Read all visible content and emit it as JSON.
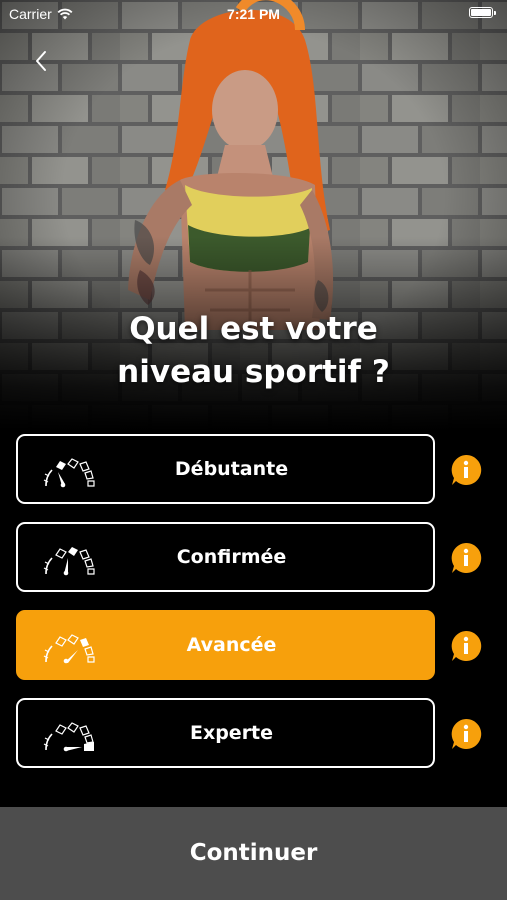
{
  "status_bar": {
    "carrier": "Carrier",
    "time": "7:21 PM"
  },
  "hero": {
    "image": "athlete-portrait"
  },
  "title": {
    "line1": "Quel est votre",
    "line2": "niveau sportif ?"
  },
  "levels": [
    {
      "label": "Débutante",
      "selected": false,
      "icon": "gauge-low-icon"
    },
    {
      "label": "Confirmée",
      "selected": false,
      "icon": "gauge-medium-icon"
    },
    {
      "label": "Avancée",
      "selected": true,
      "icon": "gauge-high-icon"
    },
    {
      "label": "Experte",
      "selected": false,
      "icon": "gauge-max-icon"
    }
  ],
  "info_icon": "info-bubble-icon",
  "continue_label": "Continuer",
  "colors": {
    "accent": "#f7a00c",
    "background": "#000000",
    "continue_bg": "#4d4d4d"
  }
}
